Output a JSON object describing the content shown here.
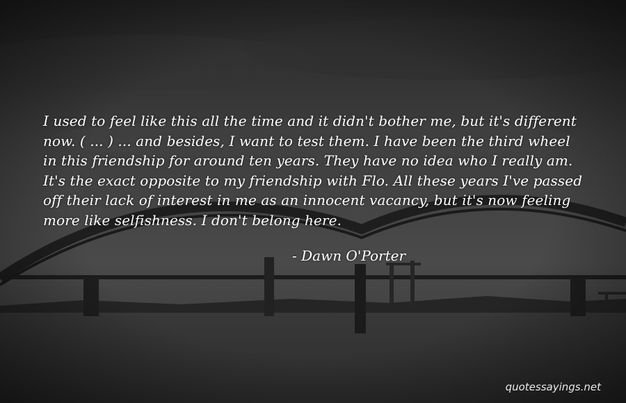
{
  "quote": {
    "text": "I used to feel like this all the time and it didn't bother me, but it's different now. ( ... ) ... and besides, I want to test them. I have been the third wheel in this friendship for around ten years. They have no idea who I really am. It's the exact opposite to my friendship with Flo. All these years I've passed off their lack of interest in me as an innocent vacancy, but it's now feeling more like selfishness. I don't belong here.",
    "author": "- Dawn O'Porter"
  },
  "watermark": "quotessayings.net",
  "background": {
    "description_icon": "bridge-photo",
    "sky_color": "#4a4a4a",
    "water_color": "#3a3a3a"
  }
}
